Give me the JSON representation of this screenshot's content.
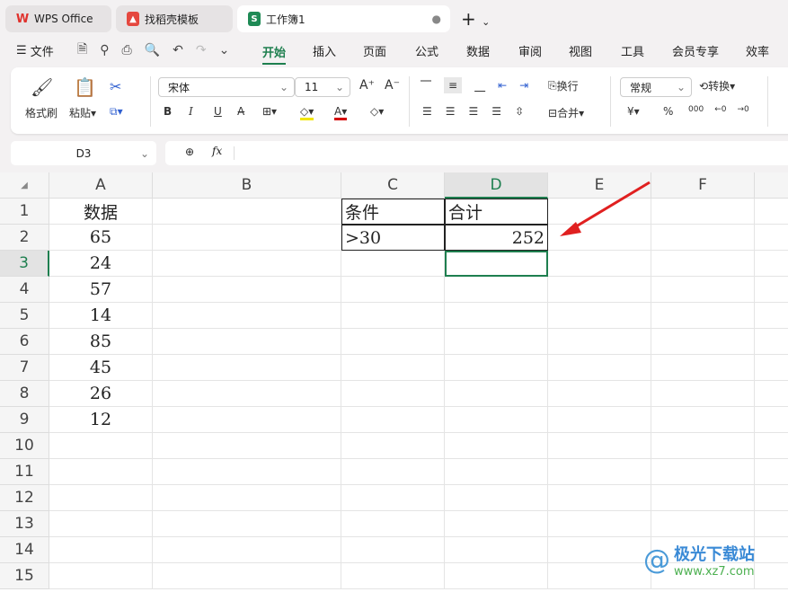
{
  "tabs": [
    {
      "label": "WPS Office",
      "icon": "wps-logo-icon"
    },
    {
      "label": "找稻壳模板",
      "icon": "docer-icon"
    },
    {
      "label": "工作簿1",
      "icon": "sheet-icon"
    }
  ],
  "menu": {
    "file": "文件",
    "items": [
      "开始",
      "插入",
      "页面",
      "公式",
      "数据",
      "审阅",
      "视图",
      "工具",
      "会员专享",
      "效率"
    ],
    "active": "开始"
  },
  "ribbon": {
    "format_painter": "格式刷",
    "paste": "粘贴",
    "font": "宋体",
    "font_size": "11",
    "wrap": "换行",
    "merge": "合并",
    "number_format": "常规",
    "convert": "转换",
    "currency": "¥",
    "percent": "%",
    "bold": "B",
    "italic": "I",
    "underline": "U"
  },
  "name_box": "D3",
  "fx": "fx",
  "columns": [
    "A",
    "B",
    "C",
    "D",
    "E",
    "F"
  ],
  "rows": [
    "1",
    "2",
    "3",
    "4",
    "5",
    "6",
    "7",
    "8",
    "9",
    "10",
    "11",
    "12",
    "13",
    "14",
    "15"
  ],
  "cells": {
    "A": [
      "数据",
      "65",
      "24",
      "57",
      "14",
      "85",
      "45",
      "26",
      "12"
    ],
    "C": [
      "条件",
      ">30"
    ],
    "D": [
      "合计",
      "252"
    ]
  },
  "selected": "D3",
  "accent": "#1e7f4f",
  "watermark": {
    "name": "极光下载站",
    "url": "www.xz7.com"
  }
}
